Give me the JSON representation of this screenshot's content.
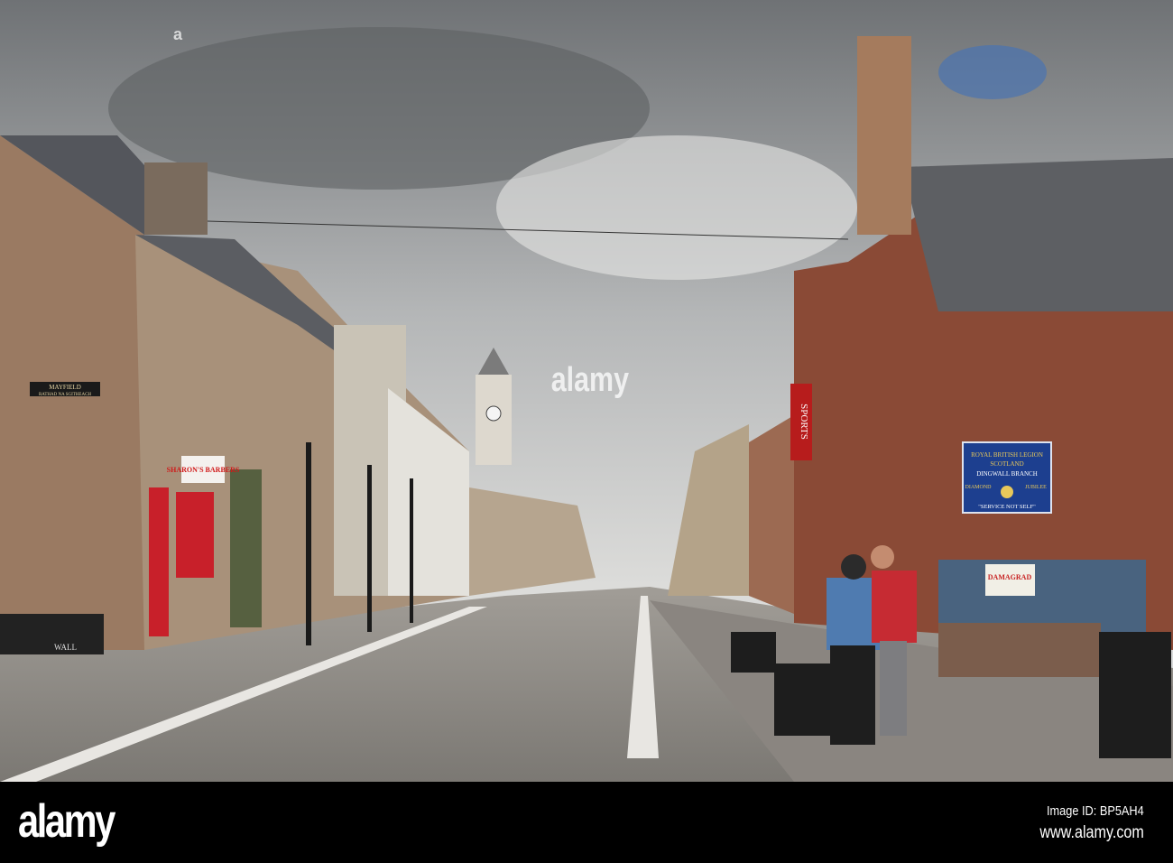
{
  "scene": {
    "street_sign": "MAYFIELD",
    "street_sign_gaelic": "RATHAD NA SGITHEACH",
    "shop_sign_barbers": "SHARON'S BARBERS",
    "shop_sign_sports": "SPORTS",
    "legion_sign": {
      "line1": "ROYAL BRITISH LEGION",
      "line2": "SCOTLAND",
      "line3": "DINGWALL BRANCH",
      "left": "DIAMOND",
      "right": "JUBILEE",
      "motto": "\"SERVICE NOT SELF\""
    },
    "planter_text": "WALL",
    "banner_text": "DAMAGRAD"
  },
  "watermark": {
    "center": "alamy",
    "small": "a"
  },
  "footer": {
    "logo": "alamy",
    "image_id": "Image ID: BP5AH4",
    "url": "www.alamy.com"
  },
  "colors": {
    "sky": "#b9bcbd",
    "stone": "#9a7a62",
    "brick": "#8a4a36",
    "road": "#8d8a86",
    "sign_blue": "#1d3f8f"
  }
}
